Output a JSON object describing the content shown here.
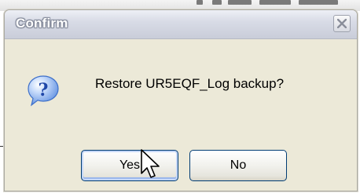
{
  "dialog": {
    "title": "Confirm",
    "message": "Restore UR5EQF_Log backup?",
    "icon": "question-icon",
    "buttons": {
      "yes_label": "Yes",
      "no_label": "No"
    }
  },
  "colors": {
    "dialog_background": "#ece9d8",
    "titlebar_top": "#eef0f6",
    "titlebar_bottom": "#c9cdd9",
    "button_border": "#003c74",
    "icon_blue": "#2c5fc8"
  }
}
